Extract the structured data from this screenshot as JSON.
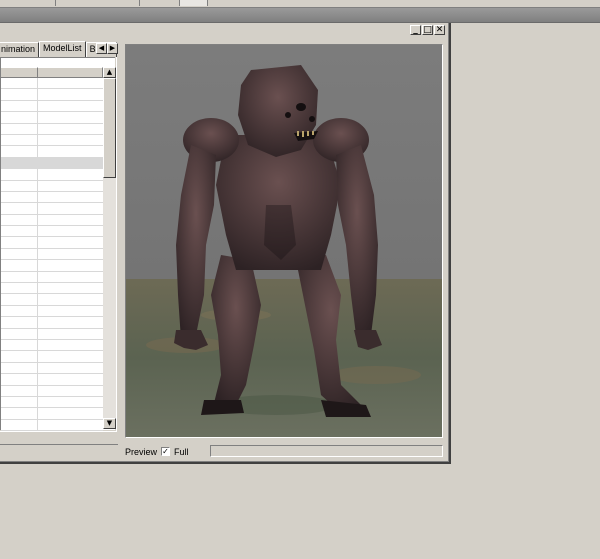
{
  "tabs": [
    {
      "label": "nimation",
      "active": false
    },
    {
      "label": "ModelList",
      "active": true
    },
    {
      "label": "Blood",
      "active": false
    }
  ],
  "window_buttons": {
    "minimize": "_",
    "maximize": "□",
    "close": "✕"
  },
  "tab_scroll": {
    "left": "◀",
    "right": "▶"
  },
  "list": {
    "selected_row_index": 7
  },
  "preview": {
    "label": "Preview",
    "full_checkbox_label": "Full",
    "full_checked": true,
    "check_mark": "✓"
  },
  "scroll": {
    "up": "▲",
    "down": "▼"
  },
  "colors": {
    "sky": "#7a7a7a",
    "ground": "#5b6351",
    "creature_skin": "#4a3637"
  }
}
